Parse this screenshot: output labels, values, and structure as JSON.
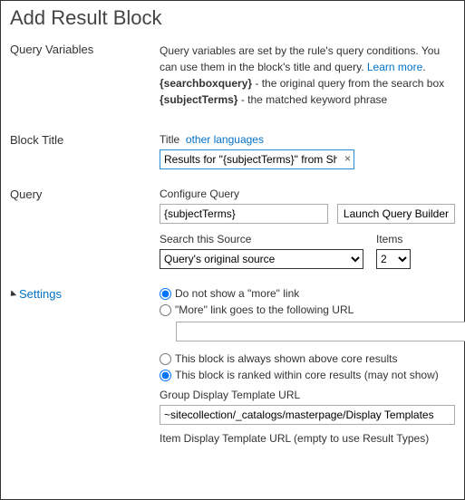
{
  "dialog": {
    "title": "Add Result Block"
  },
  "queryVariables": {
    "heading": "Query Variables",
    "desc_line1": "Query variables are set by the rule's query conditions. You can use them in the block's title and query. ",
    "learn_more": "Learn more",
    "var1_name": "{searchboxquery}",
    "var1_desc": " - the original query from the search box",
    "var2_name": "{subjectTerms}",
    "var2_desc": " - the matched keyword phrase"
  },
  "blockTitle": {
    "heading": "Block Title",
    "label": "Title",
    "other_lang": "other languages",
    "value": "Results for \"{subjectTerms}\" from SharePoint"
  },
  "query": {
    "heading": "Query",
    "configure_label": "Configure Query",
    "configure_value": "{subjectTerms}",
    "launch_btn": "Launch Query Builder",
    "source_label": "Search this Source",
    "source_value": "Query's original source",
    "items_label": "Items",
    "items_value": "2"
  },
  "settings": {
    "heading": "Settings",
    "more_none": "Do not show a \"more\" link",
    "more_url": "\"More\" link goes to the following URL",
    "more_url_value": "",
    "pos_above": "This block is always shown above core results",
    "pos_ranked": "This block is ranked within core results (may not show)",
    "group_label": "Group Display Template URL",
    "group_value": "~sitecollection/_catalogs/masterpage/Display Templates",
    "item_label": "Item Display Template URL (empty to use Result Types)"
  }
}
